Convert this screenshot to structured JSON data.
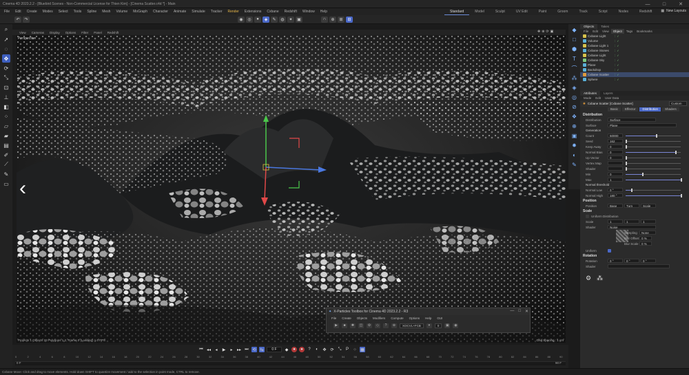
{
  "titlebar": {
    "title": "Cinema 4D 2023.2.2 - [Bluebird Scenes - Non-Commercial License for Thien Kim] - [Cinema Scatter.c4d *] - Main",
    "min": "—",
    "max": "□",
    "close": "✕"
  },
  "menubar": {
    "items": [
      "File",
      "Edit",
      "Create",
      "Modes",
      "Select",
      "Tools",
      "Spline",
      "Mesh",
      "Volume",
      "MoGraph",
      "Character",
      "Animate",
      "Simulate",
      "Tracker",
      "Render",
      "Extensions",
      "Cxbane",
      "Redshift",
      "Window",
      "Help"
    ],
    "highlight_index": 14,
    "layouts": [
      "Standard",
      "Model",
      "Sculpt",
      "UV Edit",
      "Paint",
      "Groom",
      "Track",
      "Script",
      "Nodes",
      "Redshift"
    ],
    "active_layout": 0,
    "new_layouts_label": "New Layouts"
  },
  "viewport_menu": [
    "View",
    "Cameras",
    "Display",
    "Options",
    "Filter",
    "Panel",
    "Redshift"
  ],
  "viewport": {
    "label": "Perspective",
    "stats": "Projects  1   Objects  33  Polygons 1,2,  Frame 0  (Loading) 1.0 FPS",
    "grid_spacing": "Grid Spacing : 1 cm"
  },
  "nav": {
    "prev": "‹",
    "next": "›"
  },
  "timeline": {
    "current_frame": "0 F",
    "ticks": [
      "0",
      "2",
      "4",
      "6",
      "8",
      "10",
      "12",
      "14",
      "16",
      "18",
      "20",
      "22",
      "24",
      "26",
      "28",
      "30",
      "32",
      "34",
      "36",
      "38",
      "40",
      "42",
      "44",
      "46",
      "48",
      "50",
      "52",
      "54",
      "56",
      "58",
      "60",
      "62",
      "64",
      "66",
      "68",
      "70",
      "72",
      "74",
      "76",
      "78",
      "80",
      "82",
      "84",
      "86",
      "88",
      "90"
    ],
    "start_frame": "0 F",
    "end_frame": "90 F"
  },
  "status": "Cxbane    Move: Click and drag to move elements. Hold down SHIFT to quantize movement / add to the selection in point mode, CTRL to remove.",
  "objects_panel": {
    "tabs": [
      "Objects",
      "Takes"
    ],
    "menu": [
      "File",
      "Edit",
      "View",
      "Object",
      "Tags",
      "Bookmarks"
    ],
    "menu_active": 3,
    "rows": [
      {
        "name": "Cxbane Light",
        "color": "#d7c24a"
      },
      {
        "name": "Volume",
        "color": "#5ab0d8"
      },
      {
        "name": "Cxbane Light 1",
        "color": "#d7c24a"
      },
      {
        "name": "Cxbane Stones",
        "color": "#5ab0d8"
      },
      {
        "name": "Cxbane Light",
        "color": "#d7c24a"
      },
      {
        "name": "Cxbane Sky",
        "color": "#7ec97e"
      },
      {
        "name": "Plane",
        "color": "#5ab0d8"
      },
      {
        "name": "Backdrop",
        "color": "#5ab0d8"
      },
      {
        "name": "Cxbane Scatter",
        "color": "#e09a3a"
      },
      {
        "name": "Sphere",
        "color": "#5ab0d8"
      }
    ],
    "selected_index": 8
  },
  "attributes": {
    "tabs": [
      "Attributes",
      "Layers"
    ],
    "mode_menu": [
      "Mode",
      "Edit",
      "User Data"
    ],
    "object_title": "Cxbane Scatter [Cxbane Scatter]",
    "object_dropdown": "Custom",
    "sub_tabs": [
      "Basic",
      "Effector",
      "Distribution",
      "Shaders"
    ],
    "active_sub_tab": 2,
    "section_distribution": "Distribution",
    "distribution_label": "Distribution",
    "distribution_value": "Surface",
    "surface_label": "Surface",
    "surface_value": "Plane",
    "generation_label": "Generation",
    "params": [
      {
        "label": "Count",
        "value": "50000",
        "fill": 0.55
      },
      {
        "label": "Seed",
        "value": "162",
        "fill": 0
      },
      {
        "label": "Keep Away",
        "value": "0",
        "fill": 0
      },
      {
        "label": "Normal Bias",
        "value": "0",
        "fill": 0.9
      },
      {
        "label": "Up Vector",
        "value": "0",
        "fill": 0
      },
      {
        "label": "Vertex Map",
        "value": "",
        "fill": 0
      },
      {
        "label": "Shader",
        "value": "",
        "fill": 0
      },
      {
        "label": "Min",
        "value": "0",
        "fill": 0.3
      },
      {
        "label": "Max",
        "value": "1",
        "fill": 1
      }
    ],
    "normal_threshold_label": "Normal threshold",
    "normal_params": [
      {
        "label": "Normal Low",
        "value": "0 °",
        "fill": 0.1
      },
      {
        "label": "Normal High",
        "value": "180 °",
        "fill": 1
      }
    ],
    "position_label": "Position",
    "position_row": {
      "label": "Position",
      "values": [
        "Base",
        "Turn",
        "Scale"
      ]
    },
    "scale_label": "Scale",
    "uniform_dist_label": "Uniform Distribution",
    "scale_rows": [
      {
        "label": "Scale",
        "values": [
          "1",
          "1",
          "1"
        ]
      },
      {
        "label": "Shader",
        "values": [
          "Noise"
        ]
      }
    ],
    "sampling_label": "Sampling",
    "sampling_value": "None",
    "blur_offset_label": "Blur Offset",
    "blur_offset_value": "0 %",
    "blur_scale_label": "Blur Scale",
    "blur_scale_value": "0 %",
    "uniform_label": "Uniform",
    "rotation_label": "Rotation",
    "rotation_row": {
      "label": "Rotation",
      "values": [
        "0 °",
        "0 °",
        "0 °"
      ]
    },
    "rotation_shader_label": "Shader"
  },
  "xparticles": {
    "title": "X-Particles Toolbox for Cinema 4D 2023.2.2 - R3",
    "menu": [
      "File",
      "Create",
      "Objects",
      "Modifiers",
      "Compute",
      "Options",
      "Help",
      "GUI"
    ],
    "dropdown_value": "XOCVL+FCB",
    "frame_value": "0",
    "controls": {
      "min": "—",
      "max": "□",
      "close": "✕"
    }
  }
}
